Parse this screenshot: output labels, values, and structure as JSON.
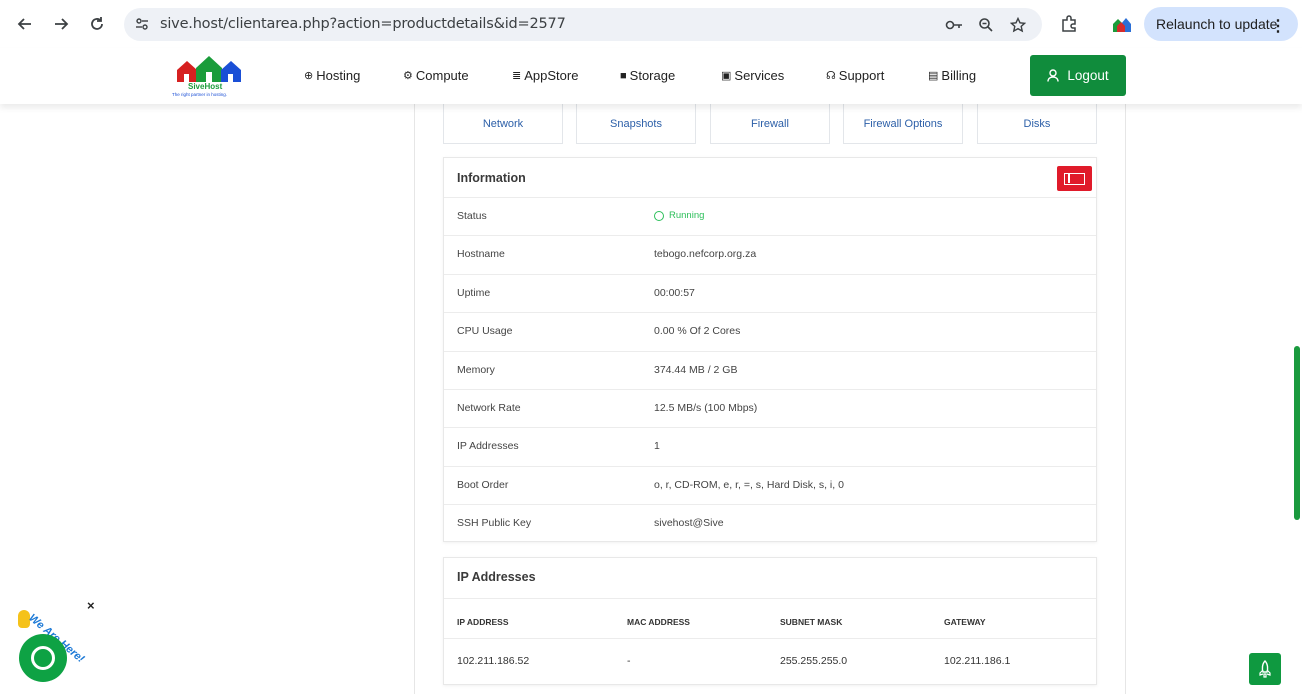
{
  "browser": {
    "url": "sive.host/clientarea.php?action=productdetails&id=2577",
    "relaunch_label": "Relaunch to update"
  },
  "site": {
    "brand_name": "SiveHost",
    "brand_tagline": "The right partner in hosting.",
    "menu": {
      "hosting": "Hosting",
      "compute": "Compute",
      "appstore": "AppStore",
      "storage": "Storage",
      "services": "Services",
      "support": "Support",
      "billing": "Billing"
    },
    "logout_label": "Logout"
  },
  "tabs": {
    "network": "Network",
    "snapshots": "Snapshots",
    "firewall": "Firewall",
    "firewall_options": "Firewall Options",
    "disks": "Disks"
  },
  "information": {
    "title": "Information",
    "rows": [
      {
        "label": "Status",
        "value": "Running"
      },
      {
        "label": "Hostname",
        "value": "tebogo.nefcorp.org.za"
      },
      {
        "label": "Uptime",
        "value": "00:00:57"
      },
      {
        "label": "CPU Usage",
        "value": "0.00 % Of 2 Cores"
      },
      {
        "label": "Memory",
        "value": "374.44 MB / 2 GB"
      },
      {
        "label": "Network Rate",
        "value": "12.5 MB/s (100 Mbps)"
      },
      {
        "label": "IP Addresses",
        "value": "1"
      },
      {
        "label": "Boot Order",
        "value": "o, r, CD-ROM, e, r, =, s, Hard Disk, s, i, 0"
      },
      {
        "label": "SSH Public Key",
        "value": "sivehost@Sive"
      }
    ]
  },
  "ip_addresses": {
    "title": "IP Addresses",
    "headers": {
      "ip": "IP ADDRESS",
      "mac": "MAC ADDRESS",
      "subnet": "SUBNET MASK",
      "gateway": "GATEWAY"
    },
    "row": {
      "ip": "102.211.186.52",
      "mac": "-",
      "subnet": "255.255.255.0",
      "gateway": "102.211.186.1"
    }
  },
  "chat_widget": {
    "text": "We Are Here!",
    "close": "×"
  },
  "colors": {
    "brand_green": "#108c3c",
    "link_blue": "#2c5fa8",
    "status_green": "#2cbf5a",
    "action_red": "#e01b2a"
  }
}
